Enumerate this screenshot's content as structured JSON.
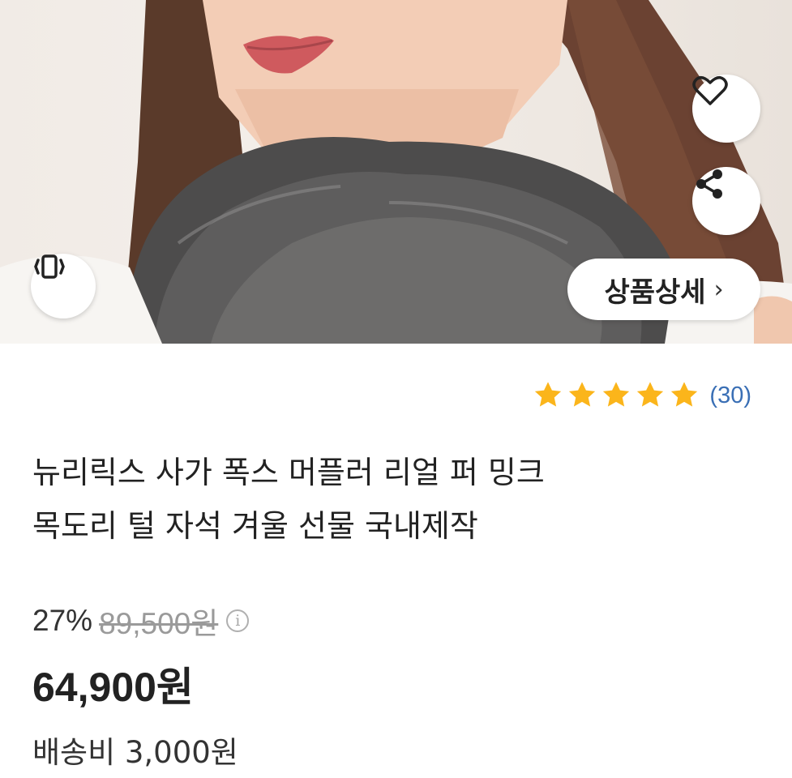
{
  "product": {
    "title_line1": "뉴리릭스 사가 폭스 머플러 리얼 퍼 밍크",
    "title_line2": "목도리 털 자석 겨울 선물 국내제작",
    "rating_stars": 5,
    "review_count": "(30)",
    "discount": "27%",
    "original_price": "89,500원",
    "sale_price": "64,900원",
    "shipping": "배송비 3,000원"
  },
  "hero": {
    "detail_button_label": "상품상세",
    "detail_chevron": "›"
  },
  "icons": {
    "wish": "heart-icon",
    "share": "share-icon",
    "vibrate": "vibrate-icon",
    "info": "info-icon",
    "star": "star-icon"
  },
  "colors": {
    "star": "#fbb51b",
    "review_count": "#3a6fb5",
    "original_price": "#9a9a9a"
  }
}
